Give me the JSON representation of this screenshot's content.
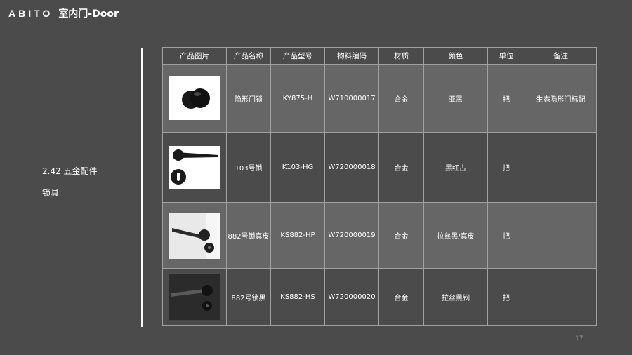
{
  "header": {
    "logo": "ABITO",
    "title": "室内门-Door"
  },
  "section": {
    "number_title": "2.42 五金配件",
    "subtitle": "锁具"
  },
  "table": {
    "columns": [
      "产品图片",
      "产品名称",
      "产品型号",
      "物料编码",
      "材质",
      "颜色",
      "单位",
      "备注"
    ],
    "rows": [
      {
        "image": "knob-lock-image",
        "name": "隐形门锁",
        "model": "KY875-H",
        "code": "W710000017",
        "material": "合金",
        "color": "亚黑",
        "unit": "把",
        "note": "生态隐形门标配"
      },
      {
        "image": "lever-handle-image",
        "name": "103号锁",
        "model": "K103-HG",
        "code": "W720000018",
        "material": "合金",
        "color": "黑红古",
        "unit": "把",
        "note": ""
      },
      {
        "image": "leather-lever-image",
        "name": "882号锁真皮",
        "model": "KS882-HP",
        "code": "W720000019",
        "material": "合金",
        "color": "拉丝黑/真皮",
        "unit": "把",
        "note": ""
      },
      {
        "image": "black-lever-image",
        "name": "882号锁黑",
        "model": "KS882-HS",
        "code": "W720000020",
        "material": "合金",
        "color": "拉丝黑钢",
        "unit": "把",
        "note": ""
      }
    ]
  },
  "page_number": "17"
}
